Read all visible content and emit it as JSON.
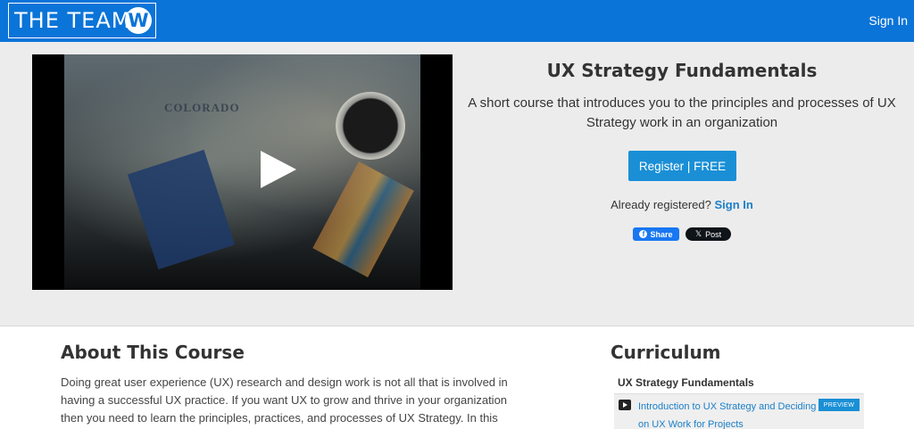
{
  "header": {
    "logo_text": "THE TEAM",
    "logo_mark": "W",
    "signin_label": "Sign In",
    "brand_color": "#0b74d8"
  },
  "hero": {
    "video": {
      "map_label": "COLORADO",
      "play_icon": "play-icon"
    },
    "title": "UX Strategy Fundamentals",
    "description": "A short course that introduces you to the principles and processes of UX Strategy work in an organization",
    "register_label": "Register | FREE",
    "already_text": "Already registered?",
    "already_link": "Sign In",
    "share": {
      "facebook_label": "Share",
      "x_label": "Post"
    }
  },
  "about": {
    "title": "About This Course",
    "text": "Doing great user experience (UX) research and design work is not all that is involved in having a successful UX practice. If you want UX to grow and thrive in your organization then you need to learn the principles, practices, and processes of UX Strategy.  In this"
  },
  "curriculum": {
    "title": "Curriculum",
    "section_title": "UX Strategy Fundamentals",
    "lessons": [
      {
        "title": "Introduction to UX Strategy and Deciding on UX Work for Projects",
        "badge": "PREVIEW",
        "icon": "video-icon"
      }
    ]
  },
  "colors": {
    "accent": "#1a8fd6",
    "link": "#1a7fc8",
    "hero_bg": "#ececec"
  }
}
